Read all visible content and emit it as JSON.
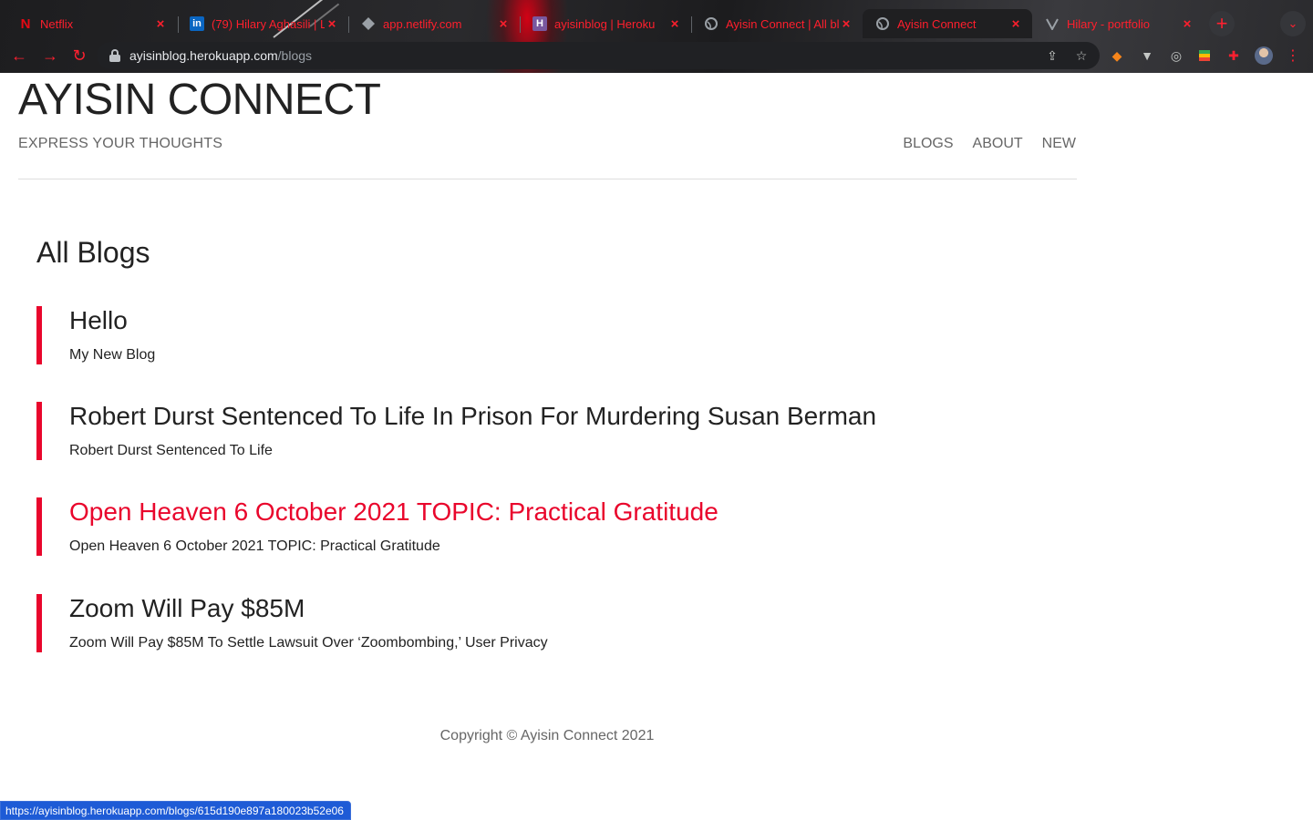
{
  "browser": {
    "tabs": [
      {
        "title": "Netflix",
        "favicon": "netflix-icon"
      },
      {
        "title": "(79) Hilary Aghasili | L",
        "favicon": "linkedin-icon"
      },
      {
        "title": "app.netlify.com",
        "favicon": "netlify-icon"
      },
      {
        "title": "ayisinblog | Heroku",
        "favicon": "heroku-icon"
      },
      {
        "title": "Ayisin Connect | All bl",
        "favicon": "globe-icon"
      },
      {
        "title": "Ayisin Connect",
        "favicon": "globe-icon"
      },
      {
        "title": "Hilary - portfolio",
        "favicon": "vercel-icon"
      }
    ],
    "active_tab_index": 5,
    "url_host": "ayisinblog.herokuapp.com",
    "url_path": "/blogs",
    "accent_color": "#ff2030",
    "status_url": "https://ayisinblog.herokuapp.com/blogs/615d190e897a180023b52e06"
  },
  "site": {
    "title": "AYISIN CONNECT",
    "tagline": "EXPRESS YOUR THOUGHTS",
    "nav": {
      "blogs": "BLOGS",
      "about": "ABOUT",
      "new": "NEW"
    }
  },
  "main": {
    "heading": "All Blogs",
    "blogs": [
      {
        "title": "Hello",
        "snippet": "My New Blog"
      },
      {
        "title": "Robert Durst Sentenced To Life In Prison For Murdering Susan Berman",
        "snippet": "Robert Durst Sentenced To Life"
      },
      {
        "title": "Open Heaven 6 October 2021 TOPIC: Practical Gratitude",
        "snippet": "Open Heaven 6 October 2021 TOPIC: Practical Gratitude"
      },
      {
        "title": "Zoom Will Pay $85M",
        "snippet": "Zoom Will Pay $85M To Settle Lawsuit Over ‘Zoombombing,’ User Privacy"
      }
    ],
    "hovered_blog_index": 2,
    "accent_color": "#e9062c"
  },
  "footer": {
    "text": "Copyright © Ayisin Connect 2021"
  }
}
